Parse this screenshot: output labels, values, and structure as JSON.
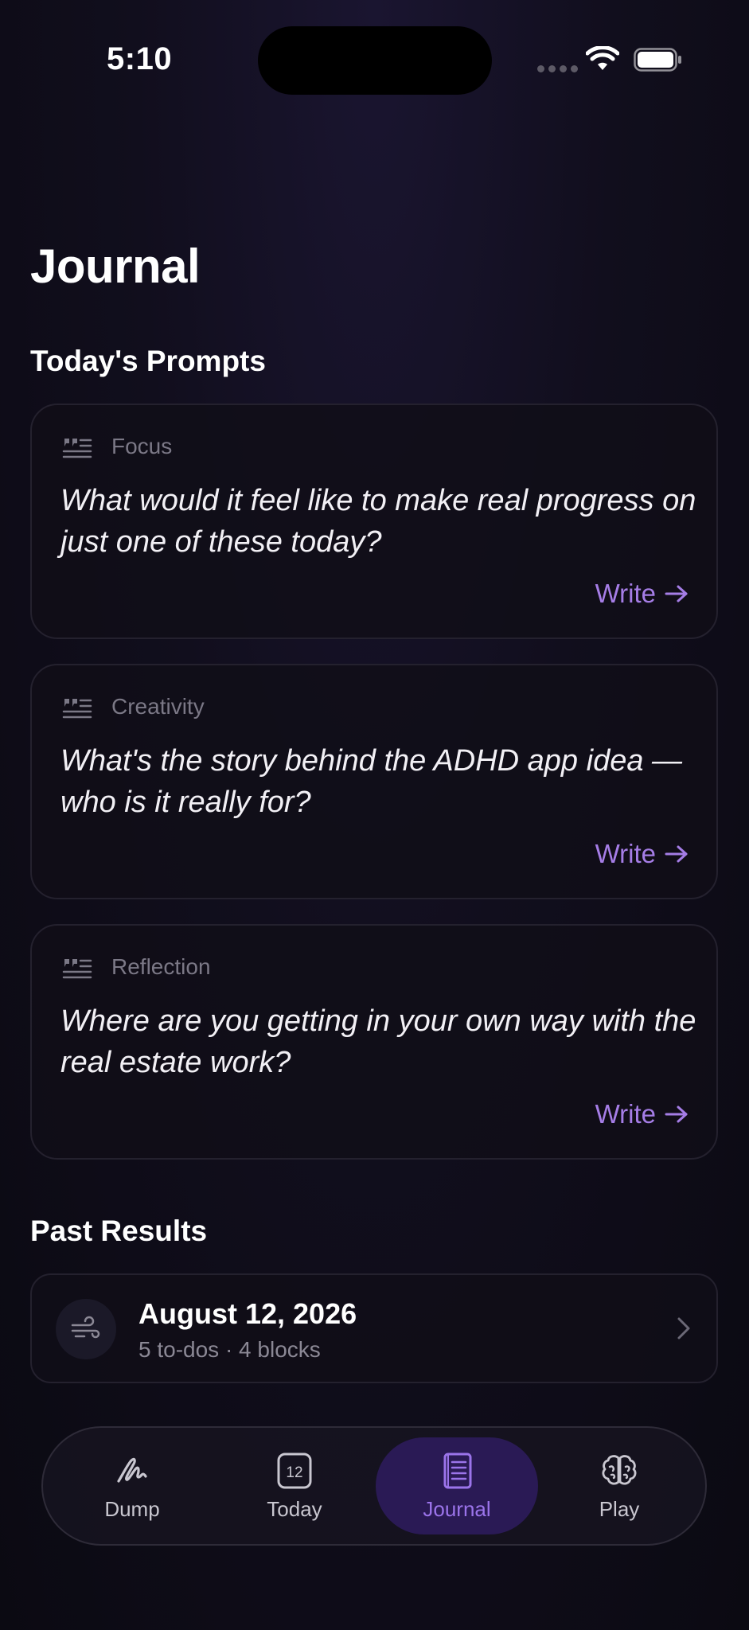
{
  "status": {
    "time": "5:10"
  },
  "page": {
    "title": "Journal"
  },
  "prompts_section": {
    "title": "Today's Prompts",
    "items": [
      {
        "category": "Focus",
        "text": "What would it feel like to make real progress on just one of these today?",
        "action": "Write"
      },
      {
        "category": "Creativity",
        "text": "What's the story behind the ADHD app idea — who is it really for?",
        "action": "Write"
      },
      {
        "category": "Reflection",
        "text": "Where are you getting in your own way with the real estate work?",
        "action": "Write"
      }
    ]
  },
  "past_section": {
    "title": "Past Results",
    "items": [
      {
        "date": "August 12, 2026",
        "summary": "5 to-dos · 4 blocks"
      }
    ]
  },
  "tabbar": {
    "tabs": [
      {
        "label": "Dump",
        "icon": "scribble-icon"
      },
      {
        "label": "Today",
        "icon": "calendar-icon",
        "badge": "12"
      },
      {
        "label": "Journal",
        "icon": "notebook-icon",
        "active": true
      },
      {
        "label": "Play",
        "icon": "brain-icon"
      }
    ]
  },
  "colors": {
    "accent": "#a57de6",
    "background": "#0d0b16",
    "active_tab_bg": "#2a1a55"
  }
}
